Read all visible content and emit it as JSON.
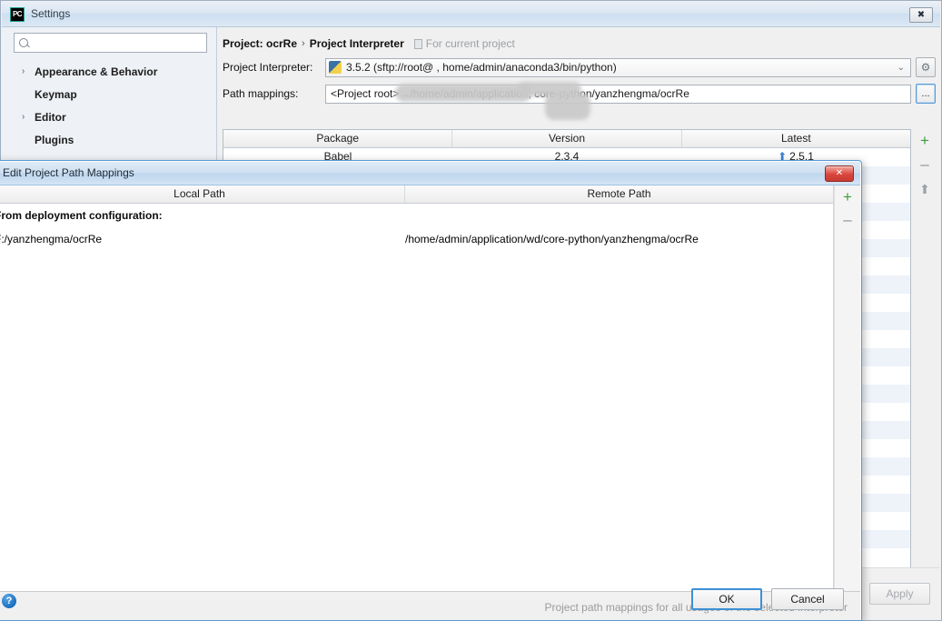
{
  "settings_window": {
    "title": "Settings",
    "logo_text": "PC",
    "close_icon": "close-icon",
    "search": {
      "value": "",
      "placeholder": ""
    },
    "sidebar": {
      "items": [
        {
          "label": "Appearance & Behavior",
          "expandable": true,
          "arrow": "›"
        },
        {
          "label": "Keymap",
          "expandable": false,
          "arrow": ""
        },
        {
          "label": "Editor",
          "expandable": true,
          "arrow": "›"
        },
        {
          "label": "Plugins",
          "expandable": false,
          "arrow": ""
        }
      ]
    },
    "breadcrumb": {
      "project": "Project: ocrRe",
      "separator": "›",
      "page": "Project Interpreter",
      "scope_note": "For current project"
    },
    "interpreter": {
      "label": "Project Interpreter:",
      "value": "3.5.2 (sftp://root@                    , home/admin/anaconda3/bin/python)",
      "dropdown_arrow": "⌄",
      "gear_icon": "gear-icon",
      "gear_glyph": "⚙"
    },
    "path_mappings": {
      "label": "Path mappings:",
      "value": "<Project root>→/home/admin/application,          core-python/yanzhengma/ocrRe",
      "browse_label": "..."
    },
    "packages_table": {
      "columns": [
        "Package",
        "Version",
        "Latest"
      ],
      "rows": [
        {
          "package": "Babel",
          "version": "2.3.4",
          "latest": "2.5.1",
          "has_update": true
        }
      ],
      "tools": [
        {
          "name": "add-package-button",
          "glyph": "+"
        },
        {
          "name": "remove-package-button",
          "glyph": "–"
        },
        {
          "name": "upgrade-package-button",
          "glyph": "⬆"
        }
      ]
    },
    "footer": {
      "apply_label": "Apply"
    }
  },
  "modal": {
    "title": "Edit Project Path Mappings",
    "close_glyph": "✕",
    "table": {
      "columns": [
        "Local Path",
        "Remote Path"
      ],
      "rows": [
        {
          "type": "group",
          "local": "From deployment configuration:",
          "remote": ""
        },
        {
          "type": "entry",
          "local": "F:/yanzhengma/ocrRe",
          "remote": "/home/admin/application/wd/core-python/yanzhengma/ocrRe"
        }
      ],
      "tools": [
        {
          "name": "add-mapping-button",
          "glyph": "+"
        },
        {
          "name": "remove-mapping-button",
          "glyph": "–"
        }
      ]
    },
    "hint": "Project path mappings for all usages of the selected interpreter",
    "help_glyph": "?",
    "buttons": {
      "ok": "OK",
      "cancel": "Cancel"
    }
  }
}
